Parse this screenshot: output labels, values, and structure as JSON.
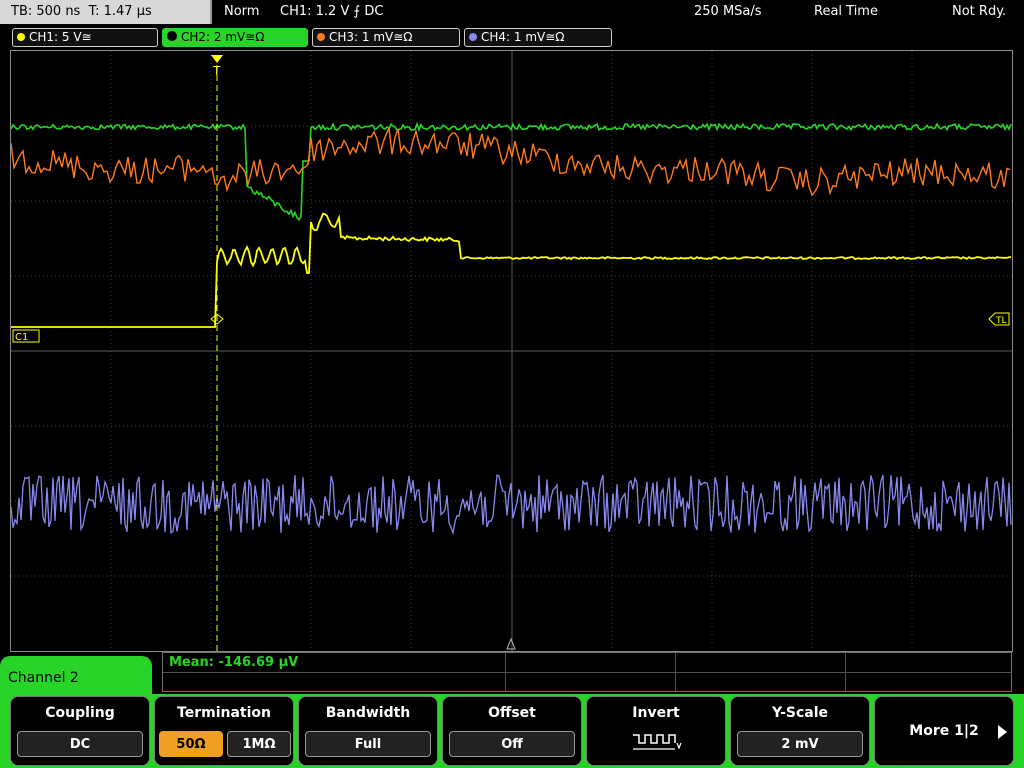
{
  "status": {
    "timebase": "TB: 500 ns",
    "trigger_time": "T: 1.47 µs",
    "mode": "Norm",
    "trigger": "CH1: 1.2 V ⨍ DC",
    "sample_rate": "250 MSa/s",
    "acq_mode": "Real Time",
    "state": "Not Rdy."
  },
  "channels": [
    {
      "label": "CH1: 5 V≅",
      "color": "#ffff00"
    },
    {
      "label": "CH2: 2 mV≅Ω",
      "color": "#27d427"
    },
    {
      "label": "CH3: 1 mV≅Ω",
      "color": "#ff7a1a"
    },
    {
      "label": "CH4: 1 mV≅Ω",
      "color": "#8888ee"
    }
  ],
  "markers": {
    "ch1": "C1",
    "trigger_level": "TL",
    "trigger_pos": "T"
  },
  "measurement": {
    "mean": "Mean: -146.69 µV"
  },
  "menu": {
    "title": "Channel 2",
    "coupling_label": "Coupling",
    "coupling_value": "DC",
    "termination_label": "Termination",
    "termination_50": "50Ω",
    "termination_1m": "1MΩ",
    "bandwidth_label": "Bandwidth",
    "bandwidth_value": "Full",
    "offset_label": "Offset",
    "offset_value": "Off",
    "invert_label": "Invert",
    "yscale_label": "Y-Scale",
    "yscale_value": "2 mV",
    "more_label": "More 1|2"
  }
}
